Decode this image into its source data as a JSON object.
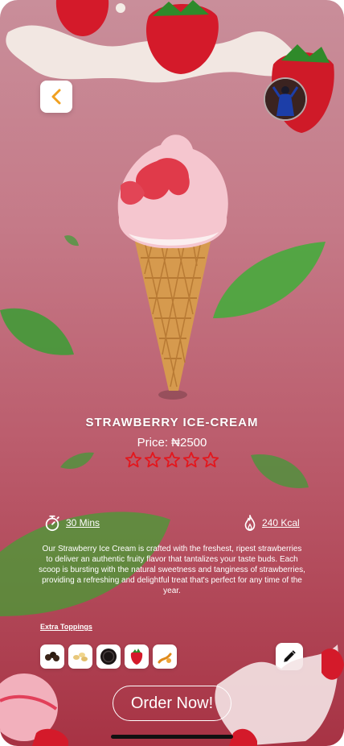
{
  "product": {
    "name": "STRAWBERRY ICE-CREAM",
    "price": "Price: ₦2500",
    "rating": 0,
    "rating_max": 5
  },
  "meta": {
    "time": "30 Mins",
    "calories": "240 Kcal"
  },
  "description": "Our Strawberry Ice Cream is crafted with the freshest, ripest strawberries to deliver an authentic fruity flavor that tantalizes your taste buds. Each scoop is bursting with the natural sweetness and tanginess of strawberries, providing a refreshing and delightful treat that's perfect for any time of the year.",
  "toppings": {
    "label": "Extra Toppings",
    "items": [
      "chocolate-chips",
      "nuts",
      "cookie",
      "strawberry",
      "caramel"
    ]
  },
  "actions": {
    "order": "Order Now!"
  },
  "colors": {
    "background_top": "#c98e9a",
    "background_bottom": "#a73344",
    "star": "#e4161c",
    "back_chevron": "#f0a020"
  }
}
